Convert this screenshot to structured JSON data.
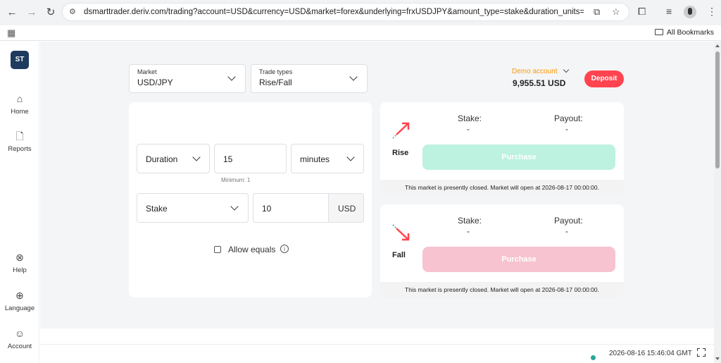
{
  "browser": {
    "url": "dsmarttrader.deriv.com/trading?account=USD&currency=USD&market=forex&underlying=frxUSDJPY&amount_type=stake&duration_units=m&duratio...",
    "bookmarks_label": "All Bookmarks"
  },
  "sidebar": {
    "logo": "ST",
    "items": [
      {
        "label": "Home",
        "icon": "home-icon"
      },
      {
        "label": "Reports",
        "icon": "document-icon"
      },
      {
        "label": "Help",
        "icon": "lifebuoy-icon"
      },
      {
        "label": "Language",
        "icon": "globe-icon"
      },
      {
        "label": "Account",
        "icon": "user-circle-icon"
      }
    ]
  },
  "market": {
    "caption": "Market",
    "value": "USD/JPY"
  },
  "trade_types": {
    "caption": "Trade types",
    "value": "Rise/Fall"
  },
  "account": {
    "label": "Demo account",
    "balance": "9,955.51 USD",
    "deposit_label": "Deposit"
  },
  "form": {
    "duration_type": "Duration",
    "duration_value": "15",
    "duration_unit": "minutes",
    "minimum_note": "Minimum: 1",
    "stake_type": "Stake",
    "stake_value": "10",
    "currency": "USD",
    "allow_equals_label": "Allow equals",
    "allow_equals_checked": false
  },
  "contracts": [
    {
      "type": "Rise",
      "stake_label": "Stake:",
      "stake_value": "-",
      "payout_label": "Payout:",
      "payout_value": "-",
      "purchase_label": "Purchase",
      "message": "This market is presently closed. Market will open at 2026-08-17 00:00:00.",
      "color": "#bdf1e0"
    },
    {
      "type": "Fall",
      "stake_label": "Stake:",
      "stake_value": "-",
      "payout_label": "Payout:",
      "payout_value": "-",
      "purchase_label": "Purchase",
      "message": "This market is presently closed. Market will open at 2026-08-17 00:00:00.",
      "color": "#f7c3d0"
    }
  ],
  "footer": {
    "datetime": "2026-08-16 15:46:04 GMT",
    "status_color": "#26a69a"
  },
  "colors": {
    "accent": "#ff444f",
    "rise_arrow": "#ff444f",
    "demo_label": "#ff9800"
  }
}
